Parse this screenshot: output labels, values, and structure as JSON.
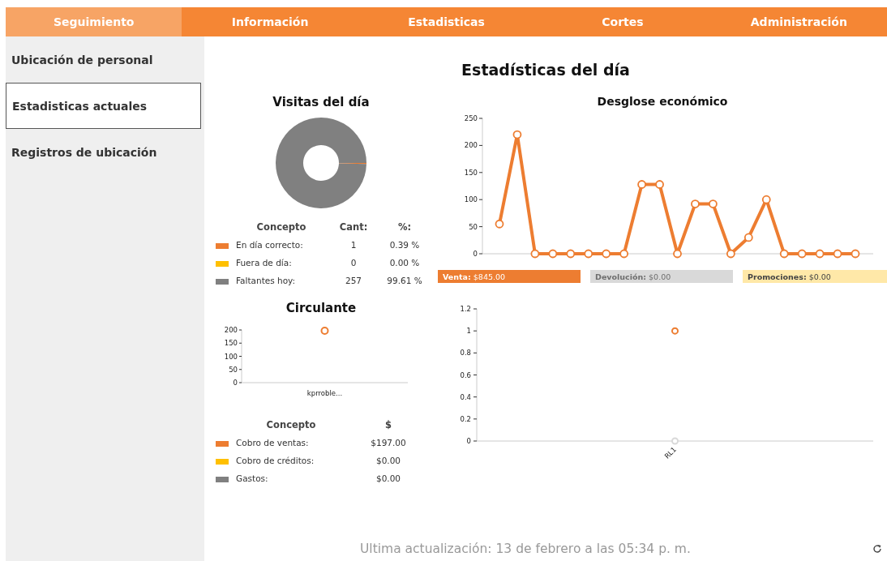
{
  "nav": [
    {
      "label": "Seguimiento",
      "selected": true
    },
    {
      "label": "Información",
      "selected": false
    },
    {
      "label": "Estadisticas",
      "selected": false
    },
    {
      "label": "Cortes",
      "selected": false
    },
    {
      "label": "Administración",
      "selected": false
    }
  ],
  "sidebar": {
    "items": [
      {
        "label": "Ubicación de personal",
        "selected": false
      },
      {
        "label": "Estadisticas actuales",
        "selected": true
      },
      {
        "label": "Registros de ubicación",
        "selected": false
      }
    ]
  },
  "title": "Estadísticas del día",
  "visitas": {
    "title": "Visitas del día",
    "chart_data": {
      "type": "donut",
      "values": [
        0.39,
        0,
        99.61
      ]
    },
    "table": {
      "columns": [
        "Concepto",
        "Cant:",
        "%:"
      ],
      "rows": [
        {
          "color": "#ed7d31",
          "label": "En día correcto:",
          "count": "1",
          "percent": "0.39 %"
        },
        {
          "color": "#ffc000",
          "label": "Fuera de día:",
          "count": "0",
          "percent": "0.00 %"
        },
        {
          "color": "#808080",
          "label": "Faltantes hoy:",
          "count": "257",
          "percent": "99.61 %"
        }
      ]
    }
  },
  "desglose": {
    "chart_data": {
      "type": "line",
      "title": "Desglose económico",
      "ylim": [
        0,
        250
      ],
      "yticks": [
        0,
        50,
        100,
        150,
        200,
        250
      ],
      "series": [
        {
          "color": "#ed7d31",
          "marker": true,
          "values": [
            55,
            220,
            0,
            0,
            0,
            0,
            0,
            0,
            128,
            128,
            0,
            92,
            92,
            0,
            30,
            100,
            0,
            0,
            0,
            0,
            0
          ]
        }
      ]
    },
    "totals": [
      {
        "label": "Venta:",
        "value": "$845.00",
        "color": "#ed7d31"
      },
      {
        "label": "Devolución:",
        "value": "$0.00",
        "color": "#d9d9d9"
      },
      {
        "label": "Promociones:",
        "value": "$0.00",
        "color": "#ffe8a8"
      }
    ]
  },
  "circulante": {
    "title": "Circulante",
    "chart_data": {
      "type": "scatter",
      "categories": [
        "kprroble..."
      ],
      "ylim": [
        0,
        200
      ],
      "yticks": [
        0,
        50,
        100,
        150,
        200
      ],
      "series": [
        {
          "color": "#ed7d31",
          "values": [
            197
          ]
        }
      ]
    },
    "table": {
      "columns": [
        "Concepto",
        "$"
      ],
      "rows": [
        {
          "color": "#ed7d31",
          "label": "Cobro de ventas:",
          "value": "$197.00"
        },
        {
          "color": "#ffc000",
          "label": "Cobro de créditos:",
          "value": "$0.00"
        },
        {
          "color": "#808080",
          "label": "Gastos:",
          "value": "$0.00"
        }
      ]
    }
  },
  "detalle": {
    "chart_data": {
      "type": "scatter",
      "categories": [
        "RL1"
      ],
      "ylim": [
        0,
        1.2
      ],
      "yticks": [
        0,
        0.2,
        0.4,
        0.6,
        0.8,
        1,
        1.2
      ],
      "series": [
        {
          "color": "#ed7d31",
          "values": [
            1
          ]
        },
        {
          "color": "#d9d9d9",
          "values": [
            0
          ]
        }
      ]
    }
  },
  "footer": {
    "text": "Ultima actualización: 13 de febrero a las 05:34 p. m."
  }
}
